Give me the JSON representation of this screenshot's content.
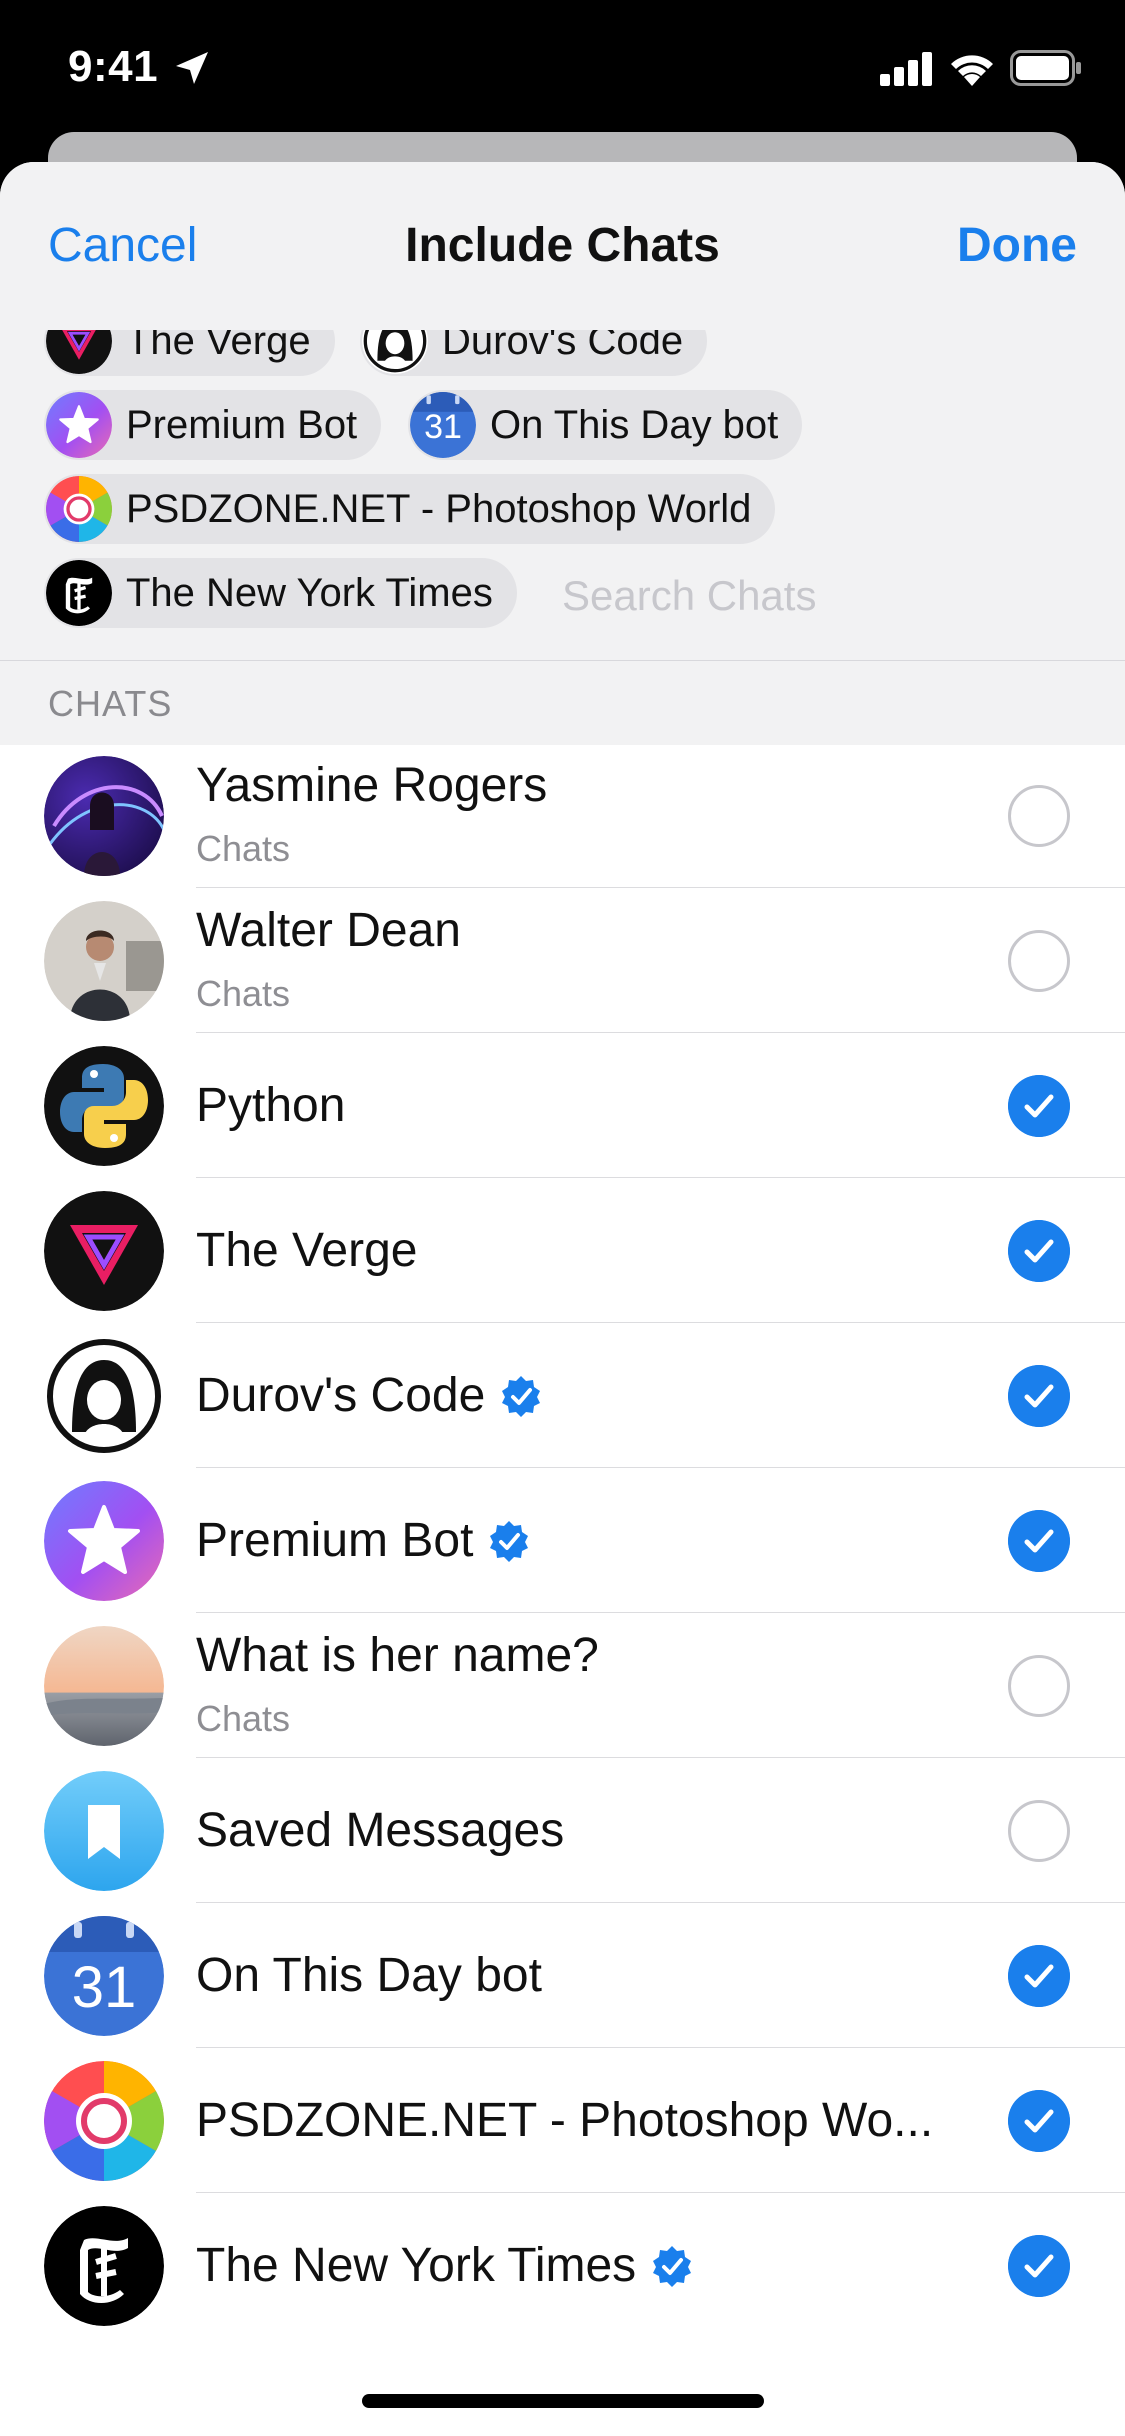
{
  "status_bar": {
    "time": "9:41"
  },
  "nav": {
    "cancel": "Cancel",
    "title": "Include Chats",
    "done": "Done"
  },
  "selected_tokens": [
    {
      "label": "The Verge"
    },
    {
      "label": "Durov's Code"
    },
    {
      "label": "Premium Bot"
    },
    {
      "label": "On This Day bot",
      "badge": "31"
    },
    {
      "label": "PSDZONE.NET - Photoshop World"
    },
    {
      "label": "The New York Times"
    }
  ],
  "search": {
    "placeholder": "Search Chats"
  },
  "section_header": "CHATS",
  "chats": [
    {
      "name": "Yasmine Rogers",
      "subtitle": "Chats",
      "checked": false
    },
    {
      "name": "Walter Dean",
      "subtitle": "Chats",
      "checked": false
    },
    {
      "name": "Python",
      "checked": true
    },
    {
      "name": "The Verge",
      "checked": true
    },
    {
      "name": "Durov's Code",
      "verified": true,
      "checked": true
    },
    {
      "name": "Premium Bot",
      "verified": true,
      "checked": true
    },
    {
      "name": "What is her name?",
      "subtitle": "Chats",
      "checked": false
    },
    {
      "name": "Saved Messages",
      "checked": false
    },
    {
      "name": "On This Day bot",
      "badge": "31",
      "checked": true
    },
    {
      "name": "PSDZONE.NET - Photoshop Wo...",
      "checked": true
    },
    {
      "name": "The New York Times",
      "verified": true,
      "checked": true
    }
  ],
  "colors": {
    "accent": "#1a7fec",
    "nav_bg": "#f2f2f3",
    "separator": "#dcdcdf"
  }
}
